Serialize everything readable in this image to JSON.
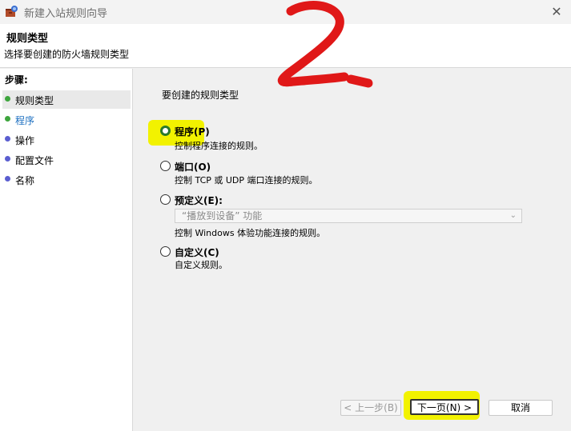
{
  "window": {
    "title": "新建入站规则向导",
    "close_glyph": "✕"
  },
  "header": {
    "title": "规则类型",
    "subtitle": "选择要创建的防火墙规则类型"
  },
  "steps": {
    "title": "步骤:",
    "items": [
      {
        "label": "规则类型",
        "state": "active",
        "dot_color": "#3ea53e"
      },
      {
        "label": "程序",
        "state": "link",
        "dot_color": "#3ea53e"
      },
      {
        "label": "操作",
        "state": "normal",
        "dot_color": "#5b5ed0"
      },
      {
        "label": "配置文件",
        "state": "normal",
        "dot_color": "#5b5ed0"
      },
      {
        "label": "名称",
        "state": "normal",
        "dot_color": "#5b5ed0"
      }
    ]
  },
  "content": {
    "question": "要创建的规则类型",
    "options": [
      {
        "label": "程序(P)",
        "desc": "控制程序连接的规则。",
        "checked": true
      },
      {
        "label": "端口(O)",
        "desc": "控制 TCP 或 UDP 端口连接的规则。",
        "checked": false
      },
      {
        "label": "预定义(E):",
        "desc": "控制 Windows 体验功能连接的规则。",
        "checked": false
      },
      {
        "label": "自定义(C)",
        "desc": "自定义规则。",
        "checked": false
      }
    ],
    "predefined_select": {
      "value": "“播放到设备” 功能",
      "disabled": true
    }
  },
  "buttons": {
    "back": "< 上一步(B)",
    "next": "下一页(N) >",
    "cancel": "取消"
  },
  "annotations": {
    "highlight_color": "#f2f200",
    "scribble_color": "#e01818",
    "scribble_text": "2."
  }
}
